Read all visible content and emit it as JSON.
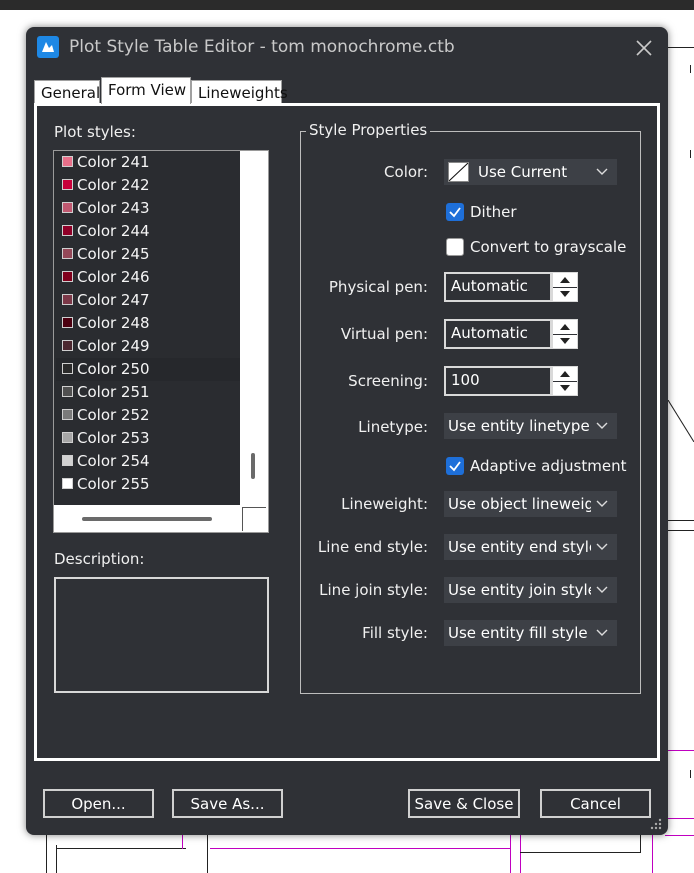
{
  "window": {
    "title": "Plot Style Table Editor - tom monochrome.ctb"
  },
  "tabs": [
    {
      "label": "General",
      "active": false
    },
    {
      "label": "Form View",
      "active": true
    },
    {
      "label": "Lineweights",
      "active": false
    }
  ],
  "plot_styles": {
    "label": "Plot styles:",
    "selected": "Color 250",
    "items": [
      {
        "label": "Color 241",
        "color": "#e8708a"
      },
      {
        "label": "Color 242",
        "color": "#c8003a"
      },
      {
        "label": "Color 243",
        "color": "#c05870"
      },
      {
        "label": "Color 244",
        "color": "#900028"
      },
      {
        "label": "Color 245",
        "color": "#944858"
      },
      {
        "label": "Color 246",
        "color": "#80001c"
      },
      {
        "label": "Color 247",
        "color": "#7c3848"
      },
      {
        "label": "Color 248",
        "color": "#4c0010"
      },
      {
        "label": "Color 249",
        "color": "#4c2830"
      },
      {
        "label": "Color 250",
        "color": "#2a2a2a"
      },
      {
        "label": "Color 251",
        "color": "#505050"
      },
      {
        "label": "Color 252",
        "color": "#7a7a7a"
      },
      {
        "label": "Color 253",
        "color": "#a6a6a6"
      },
      {
        "label": "Color 254",
        "color": "#d2d2d2"
      },
      {
        "label": "Color 255",
        "color": "#ffffff"
      }
    ]
  },
  "description": {
    "label": "Description:",
    "value": ""
  },
  "style_properties": {
    "title": "Style Properties",
    "color": {
      "label": "Color:",
      "value": "Use Current"
    },
    "dither": {
      "label": "Dither",
      "checked": true
    },
    "grayscale": {
      "label": "Convert to grayscale",
      "checked": false
    },
    "physical_pen": {
      "label": "Physical pen:",
      "value": "Automatic"
    },
    "virtual_pen": {
      "label": "Virtual pen:",
      "value": "Automatic"
    },
    "screening": {
      "label": "Screening:",
      "value": "100"
    },
    "linetype": {
      "label": "Linetype:",
      "value": "Use entity linetype"
    },
    "adaptive": {
      "label": "Adaptive adjustment",
      "checked": true
    },
    "lineweight": {
      "label": "Lineweight:",
      "value": "Use object lineweight"
    },
    "line_end": {
      "label": "Line end style:",
      "value": "Use entity end style"
    },
    "line_join": {
      "label": "Line join style:",
      "value": "Use entity join style"
    },
    "fill": {
      "label": "Fill style:",
      "value": "Use entity fill style"
    }
  },
  "buttons": {
    "open": "Open...",
    "save_as": "Save As...",
    "save_close": "Save & Close",
    "cancel": "Cancel"
  },
  "colors": {
    "dialog_bg": "#2f3136",
    "checkbox_accent": "#1e6fd9",
    "dropdown_bg": "#3d4046"
  }
}
